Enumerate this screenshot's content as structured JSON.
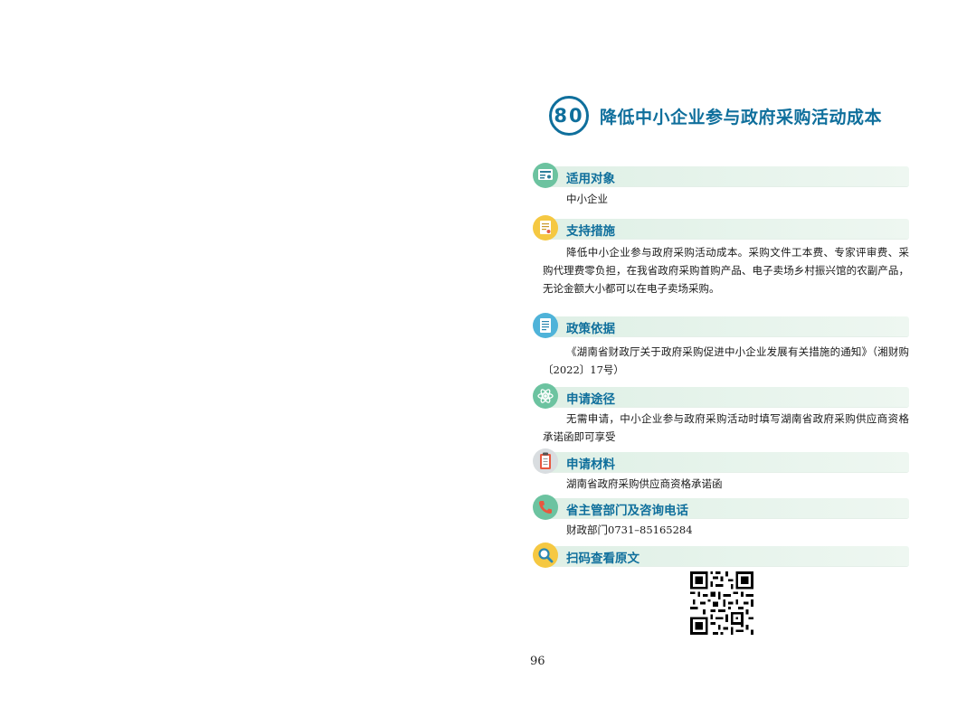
{
  "title": {
    "number": "80",
    "text": "降低中小企业参与政府采购活动成本"
  },
  "sections": [
    {
      "label": "适用对象",
      "icon": "id-card-icon",
      "color": "#6cc3a0",
      "body": "中小企业"
    },
    {
      "label": "支持措施",
      "icon": "certificate-icon",
      "color": "#f5c842",
      "body": "降低中小企业参与政府采购活动成本。采购文件工本费、专家评审费、采购代理费零负担，在我省政府采购首购产品、电子卖场乡村振兴馆的农副产品，无论金额大小都可以在电子卖场采购。"
    },
    {
      "label": "政策依据",
      "icon": "document-icon",
      "color": "#4fb3d9",
      "body": "《湖南省财政厅关于政府采购促进中小企业发展有关措施的通知》（湘财购〔2022〕17号）"
    },
    {
      "label": "申请途径",
      "icon": "atom-icon",
      "color": "#6cc3a0",
      "body": "无需申请，中小企业参与政府采购活动时填写湖南省政府采购供应商资格承诺函即可享受"
    },
    {
      "label": "申请材料",
      "icon": "clipboard-icon",
      "color": "#d9dde0",
      "body": "湖南省政府采购供应商资格承诺函"
    },
    {
      "label": "省主管部门及咨询电话",
      "icon": "phone-icon",
      "color": "#6cc3a0",
      "body": "财政部门0731–85165284"
    },
    {
      "label": "扫码查看原文",
      "icon": "magnifier-icon",
      "color": "#f5c842",
      "body": ""
    }
  ],
  "page_number": "96"
}
